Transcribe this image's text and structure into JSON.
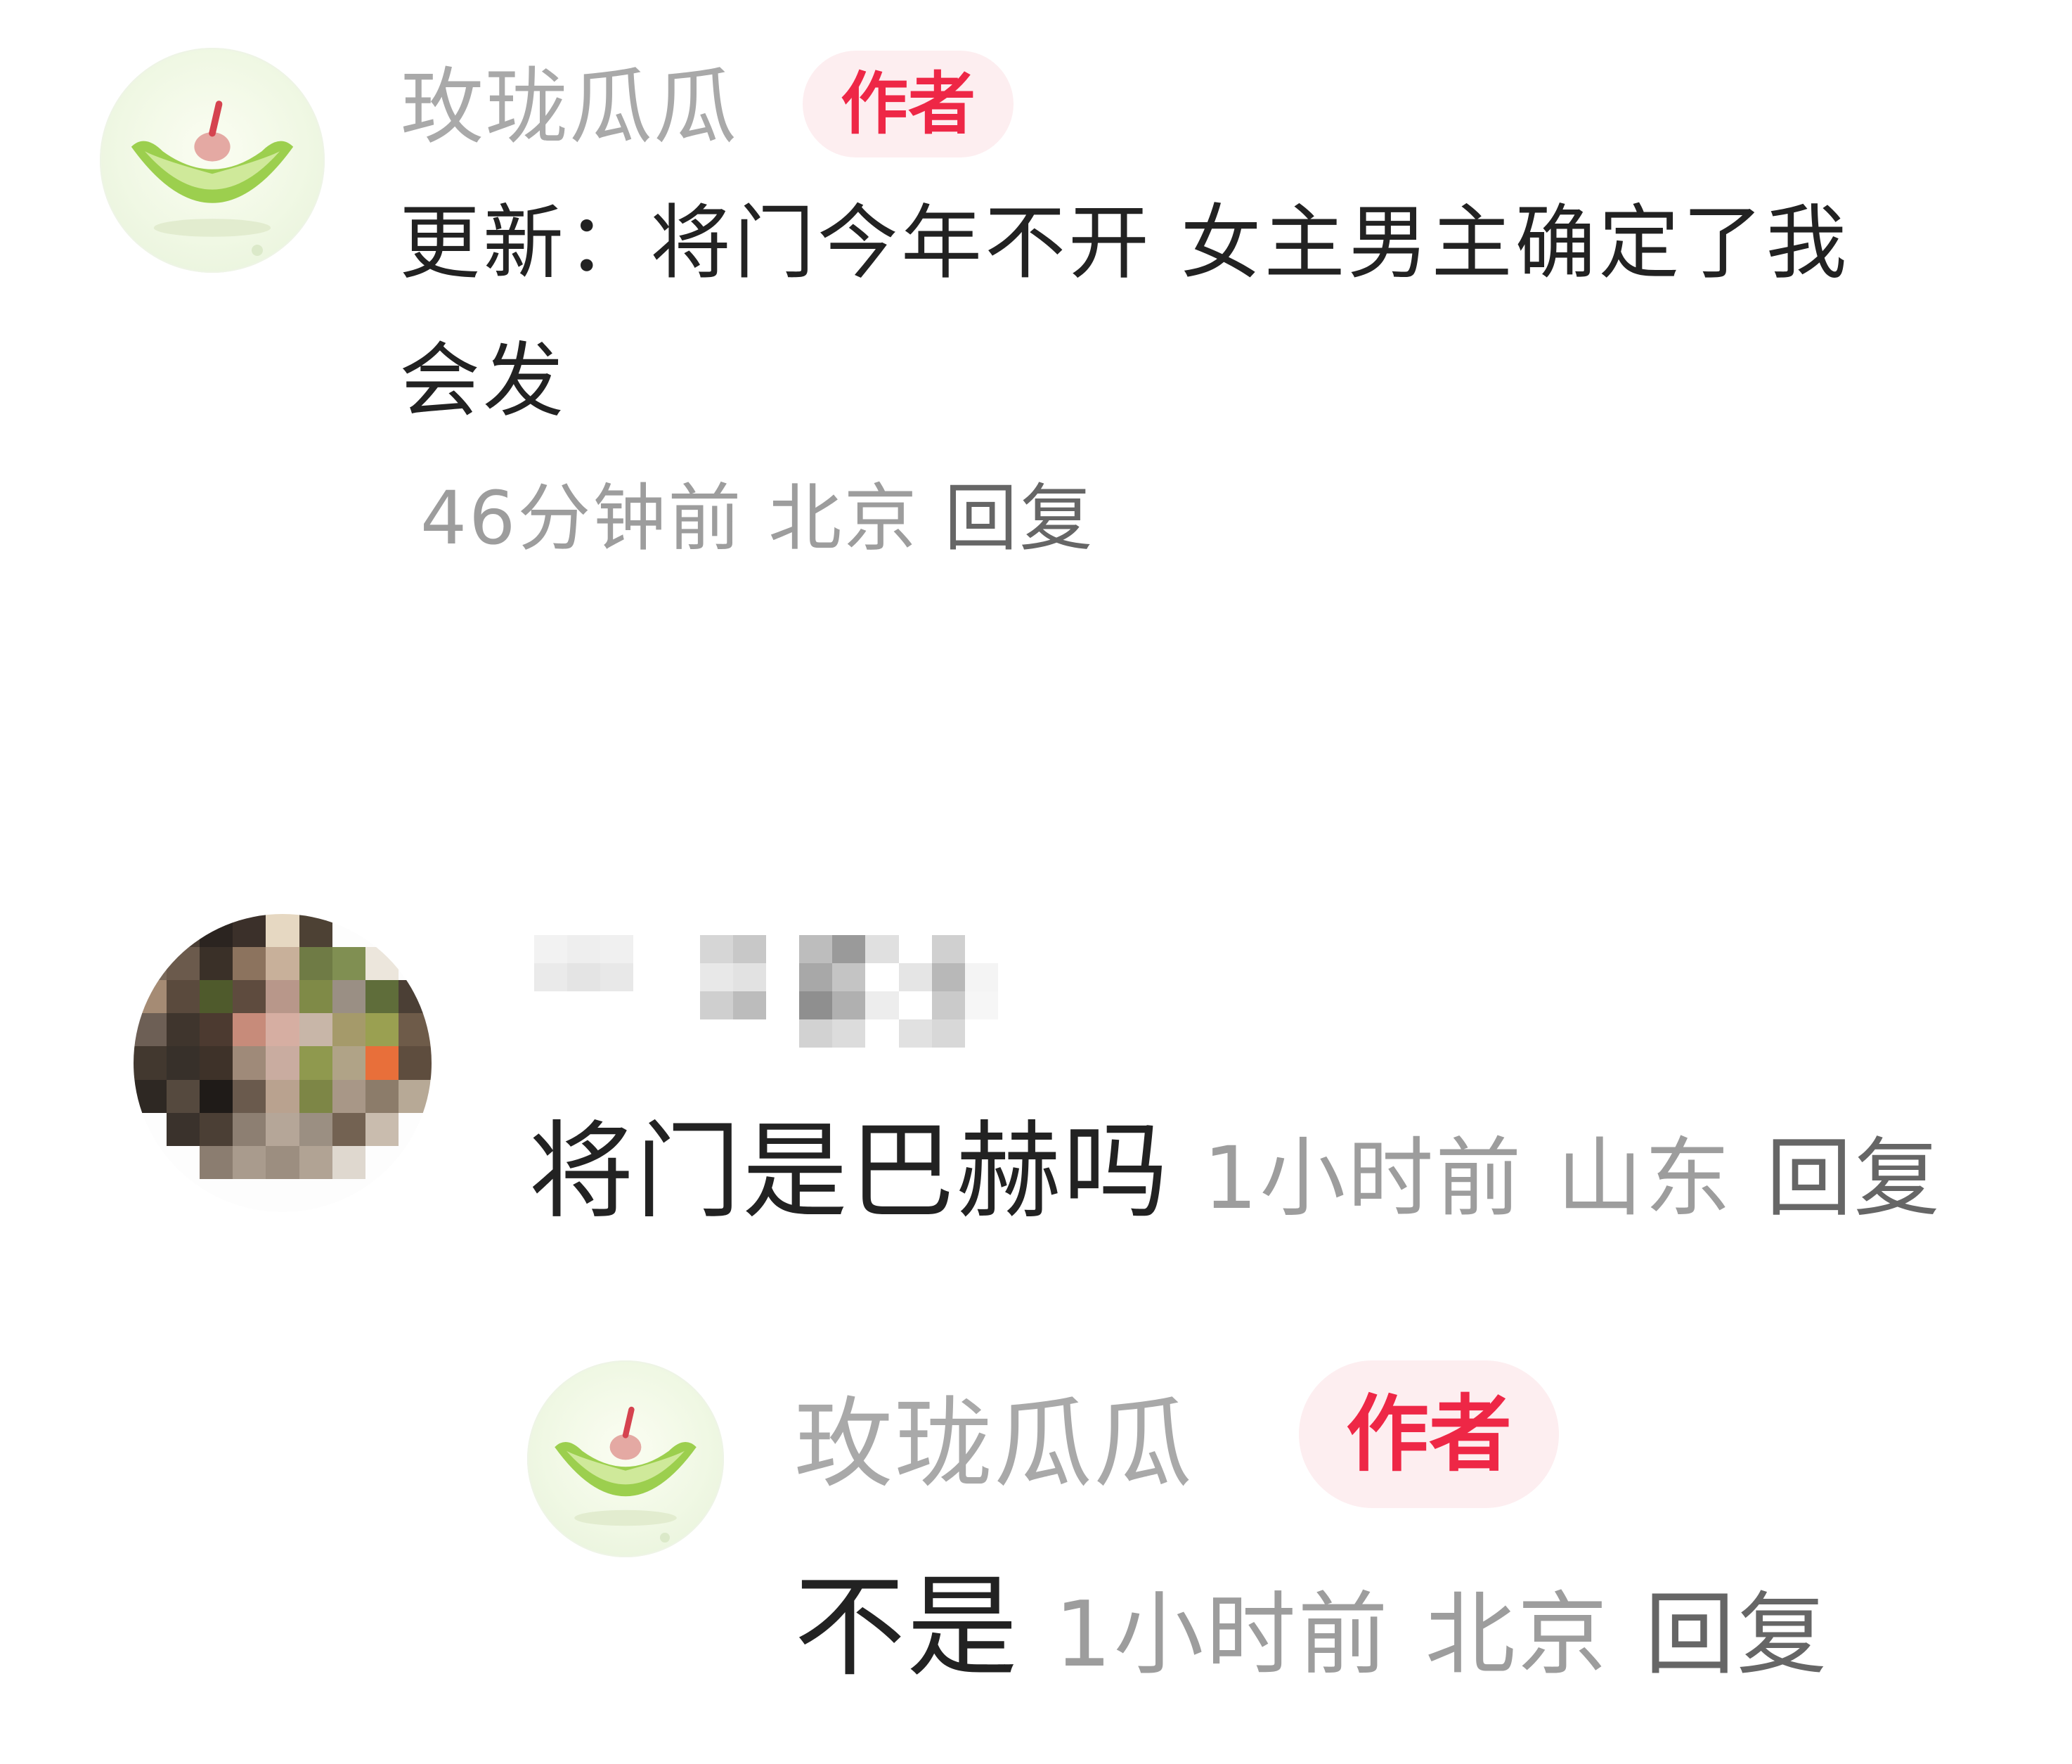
{
  "comments": [
    {
      "username": "玫珑瓜瓜",
      "badge": "作者",
      "text": "更新：将门今年不开 女主男主确定了我会发",
      "text_line1": "更新：将门今年不开 女主男主确定了我",
      "text_line2": "会发",
      "time": "46分钟前",
      "location": "北京",
      "reply_label": "回复"
    },
    {
      "username_redacted": true,
      "text": "将门是巴赫吗",
      "time": "1小时前",
      "location": "山东",
      "reply_label": "回复",
      "replies": [
        {
          "username": "玫珑瓜瓜",
          "badge": "作者",
          "text": "不是",
          "time": "1小时前",
          "location": "北京",
          "reply_label": "回复"
        }
      ]
    }
  ],
  "colors": {
    "badge_text": "#ee2746",
    "badge_bg": "#fdeef0",
    "username": "#a9a9a9",
    "body": "#222222",
    "meta": "#9d9d9d",
    "reply": "#666666"
  },
  "icons": {
    "author_avatar": "melon-avatar-icon",
    "commenter_avatar": "pixelated-avatar"
  }
}
